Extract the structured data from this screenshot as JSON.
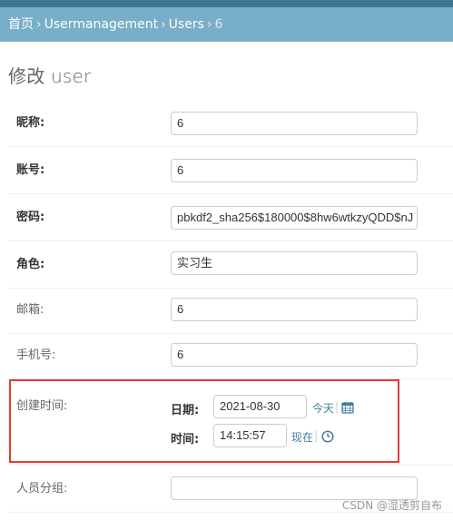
{
  "breadcrumbs": [
    "首页",
    "Usermanagement",
    "Users",
    "6"
  ],
  "page_title": "修改 user",
  "fields": [
    {
      "label": "昵称:",
      "value": "6",
      "bold": true
    },
    {
      "label": "账号:",
      "value": "6",
      "bold": true
    },
    {
      "label": "密码:",
      "value": "pbkdf2_sha256$180000$8hw6wtkzyQDD$nJ",
      "bold": true
    },
    {
      "label": "角色:",
      "value": "实习生",
      "bold": true
    },
    {
      "label": "邮箱:",
      "value": "6",
      "bold": false
    },
    {
      "label": "手机号:",
      "value": "6",
      "bold": false
    }
  ],
  "created_time": {
    "label": "创建时间:",
    "date_label": "日期:",
    "date_value": "2021-08-30",
    "today_link": "今天",
    "time_label": "时间:",
    "time_value": "14:15:57",
    "now_link": "现在"
  },
  "group_field": {
    "label": "人员分组:",
    "value": ""
  },
  "watermark": "CSDN @湿透剪自布",
  "colors": {
    "header": "#79aec8",
    "header_dark": "#417690",
    "link": "#447e9b",
    "highlight": "#e53935"
  }
}
